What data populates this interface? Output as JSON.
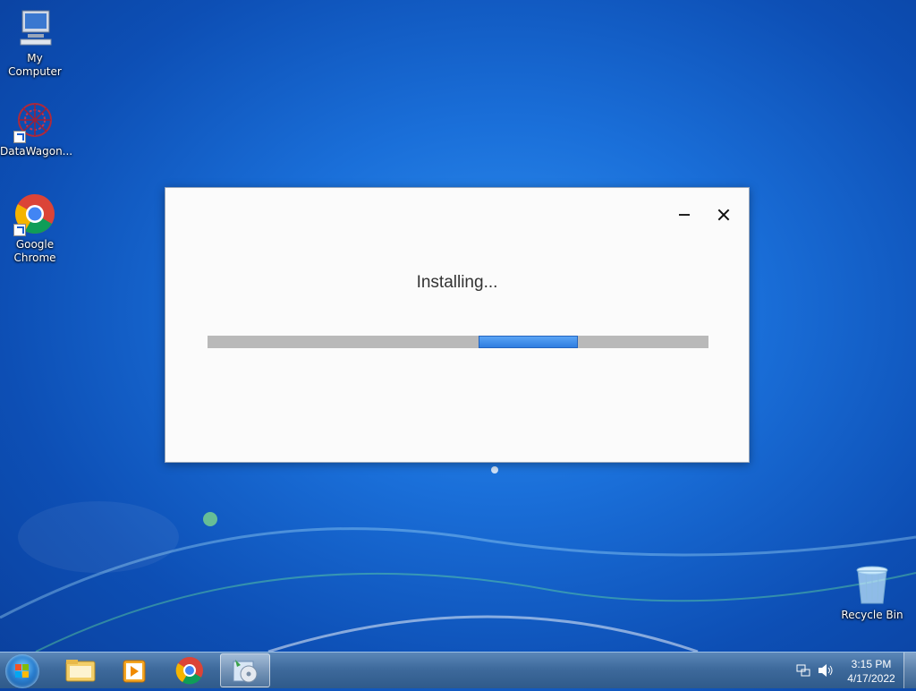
{
  "desktop": {
    "icons": [
      {
        "label": "My Computer"
      },
      {
        "label": "DataWagon..."
      },
      {
        "label": "Google Chrome"
      },
      {
        "label": "Recycle Bin"
      }
    ]
  },
  "dialog": {
    "status_text": "Installing...",
    "progress_indeterminate": true,
    "accent_color": "#3b8cf0"
  },
  "taskbar": {
    "pinned": [
      {
        "icon": "windows-explorer-icon"
      },
      {
        "icon": "media-player-icon"
      },
      {
        "icon": "chrome-icon"
      },
      {
        "icon": "installer-icon",
        "active": true
      }
    ],
    "tray": {
      "time": "3:15 PM",
      "date": "4/17/2022"
    }
  }
}
